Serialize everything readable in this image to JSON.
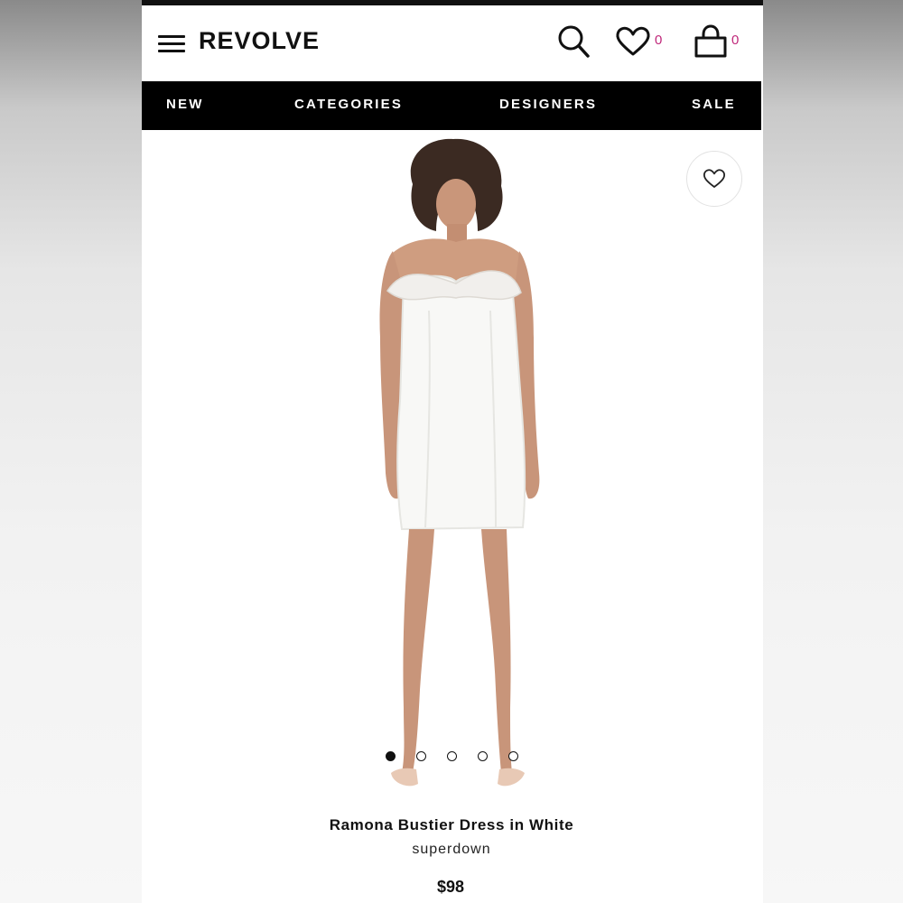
{
  "header": {
    "logo": "REVOLVE",
    "wishlist_count": "0",
    "bag_count": "0"
  },
  "nav": {
    "items": [
      "NEW",
      "CATEGORIES",
      "DESIGNERS",
      "SALE"
    ]
  },
  "product": {
    "name": "Ramona Bustier Dress in White",
    "brand": "superdown",
    "price": "$98",
    "image_count": 5,
    "active_image": 1
  },
  "colors": {
    "accent": "#c0287a",
    "nav_bg": "#000000",
    "text": "#111111"
  },
  "icons": [
    "menu-icon",
    "search-icon",
    "heart-icon",
    "bag-icon",
    "heart-outline-icon"
  ]
}
